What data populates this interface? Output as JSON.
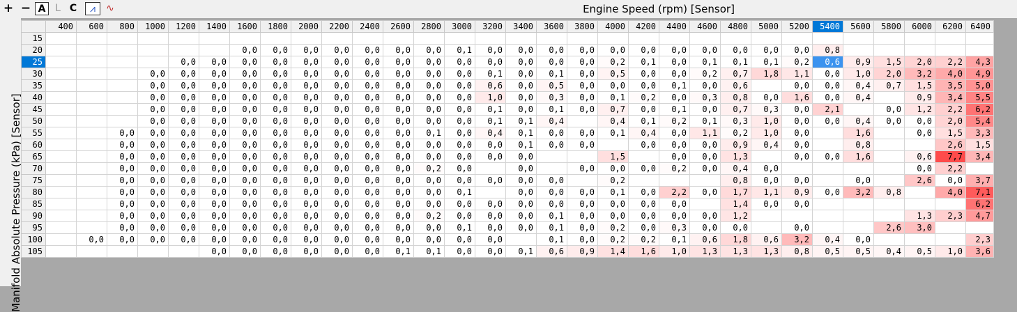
{
  "toolbar": {
    "buttons": [
      {
        "id": "cursor-plus-icon",
        "label": "+"
      },
      {
        "id": "minus-icon",
        "label": "−"
      },
      {
        "id": "mode-a-button",
        "label": "A"
      },
      {
        "id": "mode-l-button",
        "label": "L"
      },
      {
        "id": "mode-c-button",
        "label": "C"
      },
      {
        "id": "line-graph-icon",
        "label": "⩘"
      },
      {
        "id": "waveform-icon",
        "label": "∿"
      }
    ]
  },
  "x_axis_title": "Engine Speed (rpm) [Sensor]",
  "y_axis_title": "Manifold Absolute Pressure (kPa) [Sensor]",
  "selected_column": "5400",
  "selected_row": "25",
  "colors": {
    "selection": "#0078d7",
    "heat_max": "#ff4040",
    "heat_min": "#ffffff"
  },
  "columns": [
    "400",
    "600",
    "800",
    "1000",
    "1200",
    "1400",
    "1600",
    "1800",
    "2000",
    "2200",
    "2400",
    "2600",
    "2800",
    "3000",
    "3200",
    "3400",
    "3600",
    "3800",
    "4000",
    "4200",
    "4400",
    "4600",
    "4800",
    "5000",
    "5200",
    "5400",
    "5600",
    "5800",
    "6000",
    "6200",
    "6400"
  ],
  "rows": [
    {
      "label": "15",
      "cells": [
        "",
        "",
        "",
        "",
        "",
        "",
        "",
        "",
        "",
        "",
        "",
        "",
        "",
        "",
        "",
        "",
        "",
        "",
        "",
        "",
        "",
        "",
        "",
        "",
        "",
        "",
        "",
        "",
        "",
        "",
        ""
      ]
    },
    {
      "label": "20",
      "cells": [
        "",
        "",
        "",
        "",
        "",
        "",
        "0,0",
        "0,0",
        "0,0",
        "0,0",
        "0,0",
        "0,0",
        "0,0",
        "0,1",
        "0,0",
        "0,0",
        "0,0",
        "0,0",
        "0,0",
        "0,0",
        "0,0",
        "0,0",
        "0,0",
        "0,0",
        "0,0",
        "0,8",
        "",
        "",
        "",
        "",
        ""
      ]
    },
    {
      "label": "25",
      "cells": [
        "",
        "",
        "",
        "",
        "0,0",
        "0,0",
        "0,0",
        "0,0",
        "0,0",
        "0,0",
        "0,0",
        "0,0",
        "0,0",
        "0,0",
        "0,0",
        "0,0",
        "0,0",
        "0,0",
        "0,2",
        "0,1",
        "0,0",
        "0,1",
        "0,1",
        "0,1",
        "0,2",
        "0,6",
        "0,9",
        "1,5",
        "2,0",
        "2,2",
        "4,3"
      ]
    },
    {
      "label": "30",
      "cells": [
        "",
        "",
        "",
        "0,0",
        "0,0",
        "0,0",
        "0,0",
        "0,0",
        "0,0",
        "0,0",
        "0,0",
        "0,0",
        "0,0",
        "0,0",
        "0,1",
        "0,0",
        "0,1",
        "0,0",
        "0,5",
        "0,0",
        "0,0",
        "0,2",
        "0,7",
        "1,8",
        "1,1",
        "0,0",
        "1,0",
        "2,0",
        "3,2",
        "4,0",
        "4,9"
      ]
    },
    {
      "label": "35",
      "cells": [
        "",
        "",
        "",
        "0,0",
        "0,0",
        "0,0",
        "0,0",
        "0,0",
        "0,0",
        "0,0",
        "0,0",
        "0,0",
        "0,0",
        "0,0",
        "0,6",
        "0,0",
        "0,5",
        "0,0",
        "0,0",
        "0,0",
        "0,1",
        "0,0",
        "0,6",
        "",
        "0,0",
        "0,0",
        "0,4",
        "0,7",
        "1,5",
        "3,5",
        "5,0"
      ]
    },
    {
      "label": "40",
      "cells": [
        "",
        "",
        "",
        "0,0",
        "0,0",
        "0,0",
        "0,0",
        "0,0",
        "0,0",
        "0,0",
        "0,0",
        "0,0",
        "0,0",
        "0,0",
        "1,0",
        "0,0",
        "0,3",
        "0,0",
        "0,1",
        "0,2",
        "0,0",
        "0,3",
        "0,8",
        "0,0",
        "1,6",
        "0,0",
        "0,4",
        "",
        "0,9",
        "3,4",
        "5,5"
      ]
    },
    {
      "label": "45",
      "cells": [
        "",
        "",
        "",
        "0,0",
        "0,0",
        "0,0",
        "0,0",
        "0,0",
        "0,0",
        "0,0",
        "0,0",
        "0,0",
        "0,0",
        "0,0",
        "0,1",
        "0,0",
        "0,1",
        "0,0",
        "0,7",
        "0,0",
        "0,1",
        "0,0",
        "0,7",
        "0,3",
        "0,0",
        "2,1",
        "",
        "0,0",
        "1,2",
        "2,2",
        "6,2"
      ]
    },
    {
      "label": "50",
      "cells": [
        "",
        "",
        "",
        "0,0",
        "0,0",
        "0,0",
        "0,0",
        "0,0",
        "0,0",
        "0,0",
        "0,0",
        "0,0",
        "0,0",
        "0,0",
        "0,1",
        "0,1",
        "0,4",
        "",
        "0,4",
        "0,1",
        "0,2",
        "0,1",
        "0,3",
        "1,0",
        "0,0",
        "0,0",
        "0,4",
        "0,0",
        "0,0",
        "2,0",
        "5,4"
      ]
    },
    {
      "label": "55",
      "cells": [
        "",
        "",
        "0,0",
        "0,0",
        "0,0",
        "0,0",
        "0,0",
        "0,0",
        "0,0",
        "0,0",
        "0,0",
        "0,0",
        "0,1",
        "0,0",
        "0,4",
        "0,1",
        "0,0",
        "0,0",
        "0,1",
        "0,4",
        "0,0",
        "1,1",
        "0,2",
        "1,0",
        "0,0",
        "",
        "1,6",
        "",
        "0,0",
        "1,5",
        "3,3"
      ]
    },
    {
      "label": "60",
      "cells": [
        "",
        "",
        "0,0",
        "0,0",
        "0,0",
        "0,0",
        "0,0",
        "0,0",
        "0,0",
        "0,0",
        "0,0",
        "0,0",
        "0,0",
        "0,0",
        "0,0",
        "0,1",
        "0,0",
        "0,0",
        "",
        "0,0",
        "0,0",
        "0,0",
        "0,9",
        "0,4",
        "0,0",
        "",
        "0,8",
        "",
        "",
        "2,6",
        "1,5"
      ]
    },
    {
      "label": "65",
      "cells": [
        "",
        "",
        "0,0",
        "0,0",
        "0,0",
        "0,0",
        "0,0",
        "0,0",
        "0,0",
        "0,0",
        "0,0",
        "0,0",
        "0,0",
        "0,0",
        "0,0",
        "0,0",
        "",
        "",
        "1,5",
        "",
        "0,0",
        "0,0",
        "1,3",
        "",
        "0,0",
        "0,0",
        "1,6",
        "",
        "0,6",
        "7,7",
        "3,4"
      ]
    },
    {
      "label": "70",
      "cells": [
        "",
        "",
        "0,0",
        "0,0",
        "0,0",
        "0,0",
        "0,0",
        "0,0",
        "0,0",
        "0,0",
        "0,0",
        "0,0",
        "0,2",
        "0,0",
        "",
        "0,0",
        "",
        "0,0",
        "0,0",
        "0,0",
        "0,2",
        "0,0",
        "0,4",
        "0,0",
        "",
        "",
        "",
        "",
        "0,0",
        "2,2",
        ""
      ]
    },
    {
      "label": "75",
      "cells": [
        "",
        "",
        "0,0",
        "0,0",
        "0,0",
        "0,0",
        "0,0",
        "0,0",
        "0,0",
        "0,0",
        "0,0",
        "0,0",
        "0,0",
        "0,0",
        "0,0",
        "0,0",
        "0,0",
        "",
        "0,2",
        "",
        "",
        "",
        "0,8",
        "0,0",
        "0,0",
        "",
        "0,0",
        "",
        "2,6",
        "0,0",
        "3,7"
      ]
    },
    {
      "label": "80",
      "cells": [
        "",
        "",
        "0,0",
        "0,0",
        "0,0",
        "0,0",
        "0,0",
        "0,0",
        "0,0",
        "0,0",
        "0,0",
        "0,0",
        "0,0",
        "0,1",
        "",
        "0,0",
        "0,0",
        "0,0",
        "0,1",
        "0,0",
        "2,2",
        "0,0",
        "1,7",
        "1,1",
        "0,9",
        "0,0",
        "3,2",
        "0,8",
        "",
        "4,0",
        "7,1"
      ]
    },
    {
      "label": "85",
      "cells": [
        "",
        "",
        "0,0",
        "0,0",
        "0,0",
        "0,0",
        "0,0",
        "0,0",
        "0,0",
        "0,0",
        "0,0",
        "0,0",
        "0,0",
        "0,0",
        "0,0",
        "0,0",
        "0,0",
        "0,0",
        "0,0",
        "0,0",
        "0,0",
        "",
        "1,4",
        "0,0",
        "0,0",
        "",
        "",
        "",
        "",
        "",
        "6,2"
      ]
    },
    {
      "label": "90",
      "cells": [
        "",
        "",
        "0,0",
        "0,0",
        "0,0",
        "0,0",
        "0,0",
        "0,0",
        "0,0",
        "0,0",
        "0,0",
        "0,0",
        "0,2",
        "0,0",
        "0,0",
        "0,0",
        "0,1",
        "0,0",
        "0,0",
        "0,0",
        "0,0",
        "0,0",
        "1,2",
        "",
        "",
        "",
        "",
        "",
        "1,3",
        "2,3",
        "4,7"
      ]
    },
    {
      "label": "95",
      "cells": [
        "",
        "",
        "0,0",
        "0,0",
        "0,0",
        "0,0",
        "0,0",
        "0,0",
        "0,0",
        "0,0",
        "0,0",
        "0,0",
        "0,0",
        "0,1",
        "0,0",
        "0,0",
        "0,1",
        "0,0",
        "0,2",
        "0,0",
        "0,3",
        "0,0",
        "0,0",
        "",
        "0,0",
        "",
        "",
        "2,6",
        "3,0",
        "",
        ""
      ]
    },
    {
      "label": "100",
      "cells": [
        "",
        "0,0",
        "0,0",
        "0,0",
        "0,0",
        "0,0",
        "0,0",
        "0,0",
        "0,0",
        "0,0",
        "0,0",
        "0,0",
        "0,0",
        "0,0",
        "0,0",
        "",
        "0,1",
        "0,0",
        "0,2",
        "0,2",
        "0,1",
        "0,6",
        "1,8",
        "0,6",
        "3,2",
        "0,4",
        "0,0",
        "",
        "",
        "",
        "2,3"
      ]
    },
    {
      "label": "105",
      "cells": [
        "",
        "",
        "",
        "",
        "",
        "0,0",
        "0,0",
        "0,0",
        "0,0",
        "0,0",
        "0,0",
        "0,1",
        "0,1",
        "0,0",
        "0,0",
        "0,1",
        "0,6",
        "0,9",
        "1,4",
        "1,6",
        "1,0",
        "1,3",
        "1,3",
        "1,3",
        "0,8",
        "0,5",
        "0,5",
        "0,4",
        "0,5",
        "1,0",
        "3,6"
      ]
    }
  ]
}
